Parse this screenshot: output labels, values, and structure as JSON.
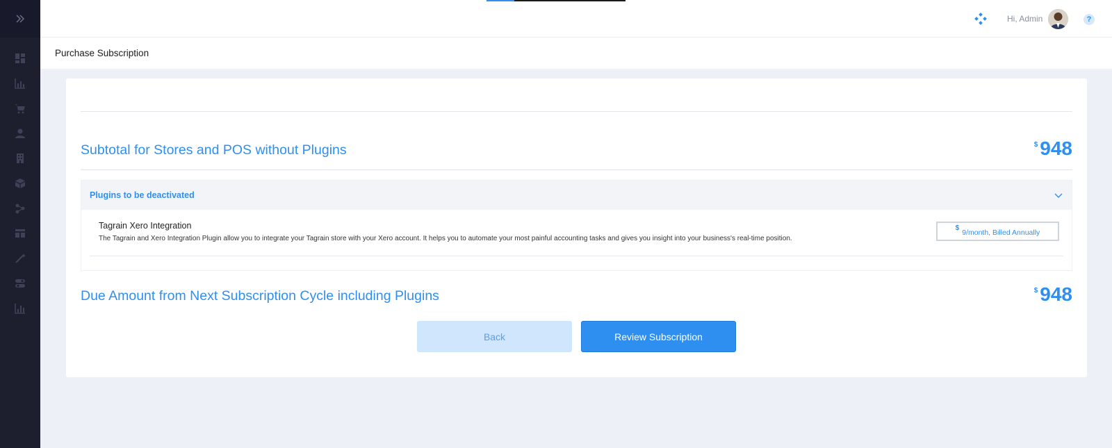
{
  "topbar": {
    "greeting": "Hi, Admin",
    "help_icon": "?"
  },
  "page": {
    "title": "Purchase Subscription"
  },
  "summary": {
    "subtotal_label": "Subtotal for Stores and POS without Plugins",
    "subtotal_currency": "$",
    "subtotal_amount": "948",
    "due_label": "Due Amount from Next Subscription Cycle including Plugins",
    "due_currency": "$",
    "due_amount": "948"
  },
  "plugins": {
    "section_label": "Plugins to be deactivated",
    "items": [
      {
        "name": "Tagrain Xero Integration",
        "description": "The Tagrain and Xero Integration Plugin allow you to integrate your Tagrain store with your Xero account. It helps you to automate your most painful accounting tasks and gives you insight into your business's real-time position.",
        "price_currency": "$",
        "price_text": "9/month, Billed Annually"
      }
    ]
  },
  "actions": {
    "back_label": "Back",
    "review_label": "Review Subscription"
  },
  "sidebar": {
    "items": [
      "dashboard-icon",
      "analytics-icon",
      "cart-icon",
      "user-icon",
      "building-icon",
      "box-icon",
      "integrations-icon",
      "table-icon",
      "magic-wand-icon",
      "toggle-settings-icon",
      "reports-icon"
    ]
  },
  "colors": {
    "accent": "#2f8ff0",
    "sidebar": "#1e1f2e",
    "background": "#eef0f7"
  }
}
